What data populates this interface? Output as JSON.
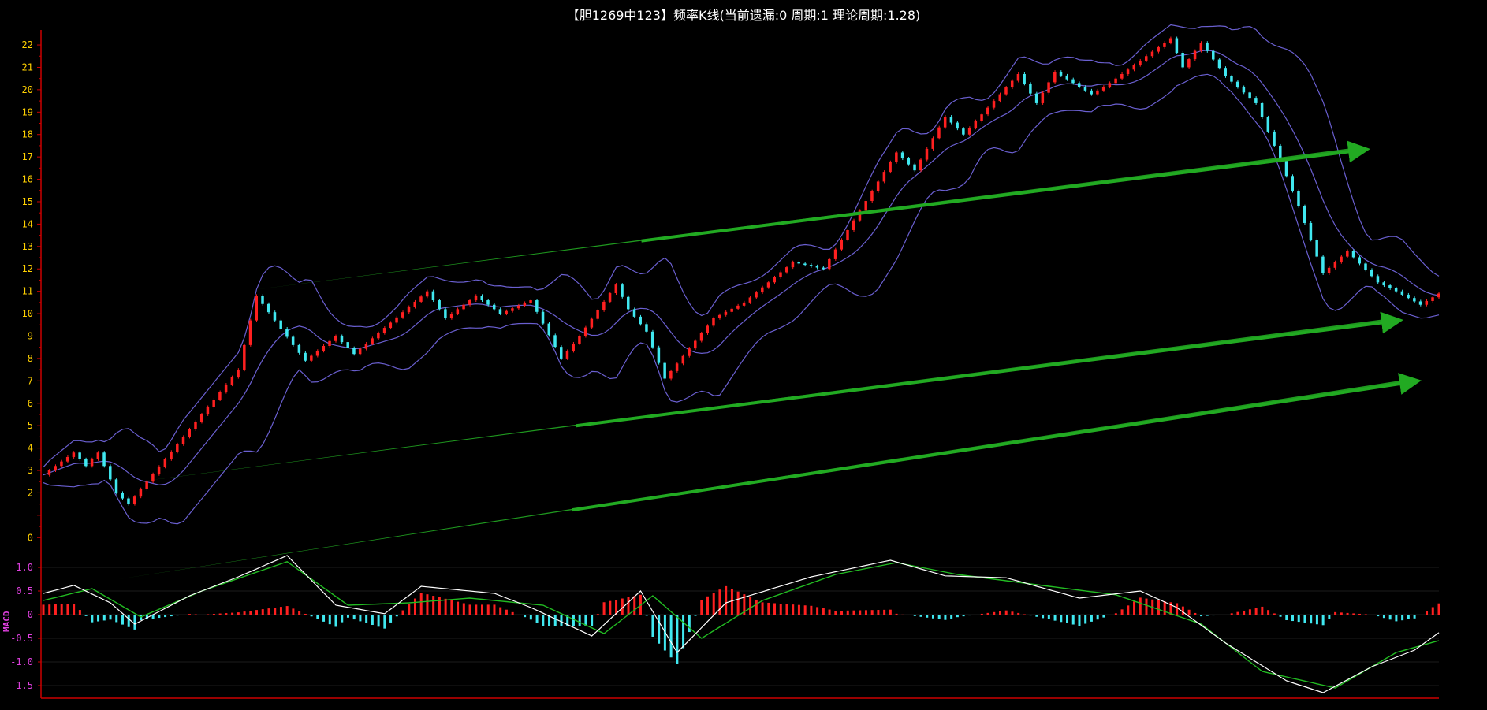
{
  "title": "【胆1269中123】频率K线(当前遗漏:0 周期:1 理论周期:1.28)",
  "colors": {
    "background": "#000000",
    "axis": "#cc0000",
    "yTickLabel": "#ffd000",
    "macdTickLabel": "#e040e0",
    "upCandle": "#ff2020",
    "downCandle": "#40e8f0",
    "bands": "#6a5fd0",
    "trendArrow": "#22aa22",
    "dif": "#ffffff",
    "dea": "#22bb22"
  },
  "chart_data": [
    {
      "type": "candlestick",
      "name": "频率K线",
      "ylim": [
        -0.8,
        22.6
      ],
      "yticks": [
        0,
        2,
        3,
        4,
        5,
        6,
        7,
        8,
        9,
        10,
        11,
        12,
        13,
        14,
        15,
        16,
        17,
        18,
        19,
        20,
        21,
        22
      ],
      "x_count": 230,
      "close_path": [
        [
          0,
          2.8
        ],
        [
          5,
          3.8
        ],
        [
          7,
          3.2
        ],
        [
          9,
          3.8
        ],
        [
          12,
          2.0
        ],
        [
          14,
          1.5
        ],
        [
          32,
          7.5
        ],
        [
          35,
          10.8
        ],
        [
          41,
          8.6
        ],
        [
          43,
          7.9
        ],
        [
          48,
          9.0
        ],
        [
          51,
          8.2
        ],
        [
          63,
          11.0
        ],
        [
          66,
          9.8
        ],
        [
          71,
          10.8
        ],
        [
          75,
          10.0
        ],
        [
          80,
          10.6
        ],
        [
          85,
          8.0
        ],
        [
          88,
          9.0
        ],
        [
          94,
          11.3
        ],
        [
          96,
          10.2
        ],
        [
          99,
          9.2
        ],
        [
          102,
          7.1
        ],
        [
          110,
          9.8
        ],
        [
          115,
          10.5
        ],
        [
          123,
          12.3
        ],
        [
          128,
          12.0
        ],
        [
          140,
          17.2
        ],
        [
          143,
          16.4
        ],
        [
          148,
          18.8
        ],
        [
          151,
          18.0
        ],
        [
          160,
          20.7
        ],
        [
          163,
          19.4
        ],
        [
          166,
          20.8
        ],
        [
          172,
          19.8
        ],
        [
          175,
          20.3
        ],
        [
          185,
          22.3
        ],
        [
          187,
          21.0
        ],
        [
          190,
          22.1
        ],
        [
          194,
          20.6
        ],
        [
          199,
          19.4
        ],
        [
          202,
          17.5
        ],
        [
          206,
          14.8
        ],
        [
          210,
          11.8
        ],
        [
          214,
          12.8
        ],
        [
          219,
          11.4
        ],
        [
          222,
          11.0
        ],
        [
          226,
          10.4
        ],
        [
          229,
          10.9
        ]
      ],
      "bollinger_bands": [
        "upper",
        "middle",
        "lower"
      ]
    },
    {
      "type": "line",
      "name": "MACD",
      "label": "MACD",
      "ylim": [
        -1.75,
        1.25
      ],
      "yticks": [
        1.0,
        0.5,
        0,
        -0.5,
        -1.0,
        -1.5
      ],
      "series": [
        {
          "name": "",
          "role": "dif",
          "points": [
            [
              0,
              0.45
            ],
            [
              5,
              0.62
            ],
            [
              11,
              0.25
            ],
            [
              15,
              -0.2
            ],
            [
              24,
              0.4
            ],
            [
              32,
              0.8
            ],
            [
              40,
              1.25
            ],
            [
              48,
              0.2
            ],
            [
              56,
              0.02
            ],
            [
              62,
              0.6
            ],
            [
              74,
              0.45
            ],
            [
              80,
              0.15
            ],
            [
              90,
              -0.45
            ],
            [
              98,
              0.5
            ],
            [
              104,
              -0.8
            ],
            [
              112,
              0.25
            ],
            [
              126,
              0.8
            ],
            [
              139,
              1.15
            ],
            [
              148,
              0.82
            ],
            [
              158,
              0.78
            ],
            [
              170,
              0.35
            ],
            [
              180,
              0.5
            ],
            [
              186,
              0.15
            ],
            [
              194,
              -0.6
            ],
            [
              204,
              -1.4
            ],
            [
              210,
              -1.65
            ],
            [
              218,
              -1.1
            ],
            [
              225,
              -0.75
            ],
            [
              229,
              -0.38
            ]
          ]
        },
        {
          "name": "",
          "role": "dea",
          "points": [
            [
              0,
              0.3
            ],
            [
              8,
              0.55
            ],
            [
              16,
              -0.05
            ],
            [
              26,
              0.5
            ],
            [
              40,
              1.12
            ],
            [
              50,
              0.2
            ],
            [
              60,
              0.25
            ],
            [
              70,
              0.35
            ],
            [
              82,
              0.2
            ],
            [
              92,
              -0.4
            ],
            [
              100,
              0.4
            ],
            [
              108,
              -0.5
            ],
            [
              118,
              0.3
            ],
            [
              130,
              0.85
            ],
            [
              140,
              1.1
            ],
            [
              150,
              0.85
            ],
            [
              162,
              0.65
            ],
            [
              176,
              0.42
            ],
            [
              190,
              -0.2
            ],
            [
              200,
              -1.2
            ],
            [
              212,
              -1.55
            ],
            [
              222,
              -0.8
            ],
            [
              229,
              -0.55
            ]
          ]
        }
      ],
      "histogram": "MACD bars (red positive, cyan negative)"
    }
  ],
  "trend_arrows": 3
}
